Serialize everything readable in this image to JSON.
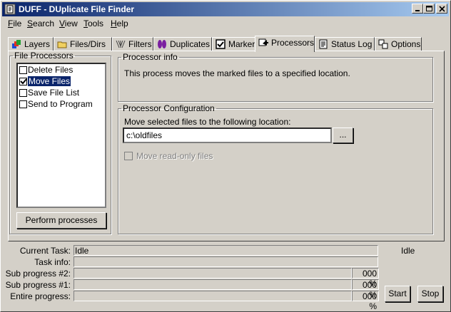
{
  "window": {
    "title": "DUFF - DUplicate File Finder"
  },
  "menu": [
    {
      "label": "File",
      "u": "F",
      "rest": "ile"
    },
    {
      "label": "Search",
      "u": "S",
      "rest": "earch"
    },
    {
      "label": "View",
      "u": "V",
      "rest": "iew"
    },
    {
      "label": "Tools",
      "u": "T",
      "rest": "ools"
    },
    {
      "label": "Help",
      "u": "H",
      "rest": "elp"
    }
  ],
  "tabs": [
    {
      "label": "Layers",
      "icon": "layers-icon"
    },
    {
      "label": "Files/Dirs",
      "icon": "folder-icon"
    },
    {
      "label": "Filters",
      "icon": "filter-icon"
    },
    {
      "label": "Duplicates",
      "icon": "duplicates-icon"
    },
    {
      "label": "Markers",
      "icon": "checkbox-icon"
    },
    {
      "label": "Processors",
      "icon": "processors-icon"
    },
    {
      "label": "Status Log",
      "icon": "log-icon"
    },
    {
      "label": "Options",
      "icon": "options-icon"
    }
  ],
  "file_processors": {
    "title": "File Processors",
    "items": [
      {
        "label": "Delete Files",
        "checked": false,
        "selected": false
      },
      {
        "label": "Move Files",
        "checked": true,
        "selected": true
      },
      {
        "label": "Save File List",
        "checked": false,
        "selected": false
      },
      {
        "label": "Send to Program",
        "checked": false,
        "selected": false
      }
    ],
    "perform_button": "Perform processes"
  },
  "processor_info": {
    "title": "Processor info",
    "text": "This process moves the marked files to a specified location."
  },
  "processor_config": {
    "title": "Processor Configuration",
    "location_label": "Move selected files to the following location:",
    "location_value": "c:\\oldfiles",
    "browse_button": "...",
    "move_readonly_label": "Move read-only files"
  },
  "status": {
    "current_task_label": "Current Task:",
    "current_task_value": "Idle",
    "current_task_side": "Idle",
    "task_info_label": "Task info:",
    "sub2_label": "Sub progress #2:",
    "sub2_pct": "000 %",
    "sub1_label": "Sub progress #1:",
    "sub1_pct": "000 %",
    "entire_label": "Entire progress:",
    "entire_pct": "000 %",
    "start_button": "Start",
    "stop_button": "Stop"
  }
}
